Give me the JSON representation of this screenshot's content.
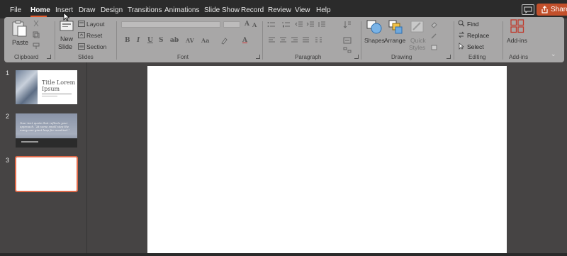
{
  "menu": {
    "tabs": [
      {
        "label": "File"
      },
      {
        "label": "Home"
      },
      {
        "label": "Insert"
      },
      {
        "label": "Draw"
      },
      {
        "label": "Design"
      },
      {
        "label": "Transitions"
      },
      {
        "label": "Animations"
      },
      {
        "label": "Slide Show"
      },
      {
        "label": "Record"
      },
      {
        "label": "Review"
      },
      {
        "label": "View"
      },
      {
        "label": "Help"
      }
    ],
    "active_tab": "Home",
    "share_label": "Share",
    "share_icon": "share-icon",
    "comment_icon": "comment-icon"
  },
  "ribbon": {
    "clipboard": {
      "paste_label": "Paste",
      "group_label": "Clipboard"
    },
    "slides": {
      "new_slide_label": "New\nSlide",
      "new_label": "New",
      "slide_label": "Slide",
      "layout_label": "Layout",
      "reset_label": "Reset",
      "section_label": "Section",
      "group_label": "Slides"
    },
    "font": {
      "group_label": "Font"
    },
    "paragraph": {
      "group_label": "Paragraph"
    },
    "drawing": {
      "shapes_label": "Shapes",
      "arrange_label": "Arrange",
      "quick_styles_label": "Quick",
      "quick_styles_label2": "Styles",
      "group_label": "Drawing"
    },
    "editing": {
      "find_label": "Find",
      "replace_label": "Replace",
      "select_label": "Select",
      "group_label": "Editing"
    },
    "addins": {
      "addins_label": "Add-ins",
      "group_label": "Add-ins"
    },
    "accent_color": "#c3502b"
  },
  "thumbnails": {
    "slides": [
      {
        "number": "1",
        "title": "Title Lorem Ipsum"
      },
      {
        "number": "2",
        "quote": "Your text quote that reflects your approach. “At some small step the many one giant leap for mankind.”"
      },
      {
        "number": "3",
        "selected": true
      }
    ]
  }
}
